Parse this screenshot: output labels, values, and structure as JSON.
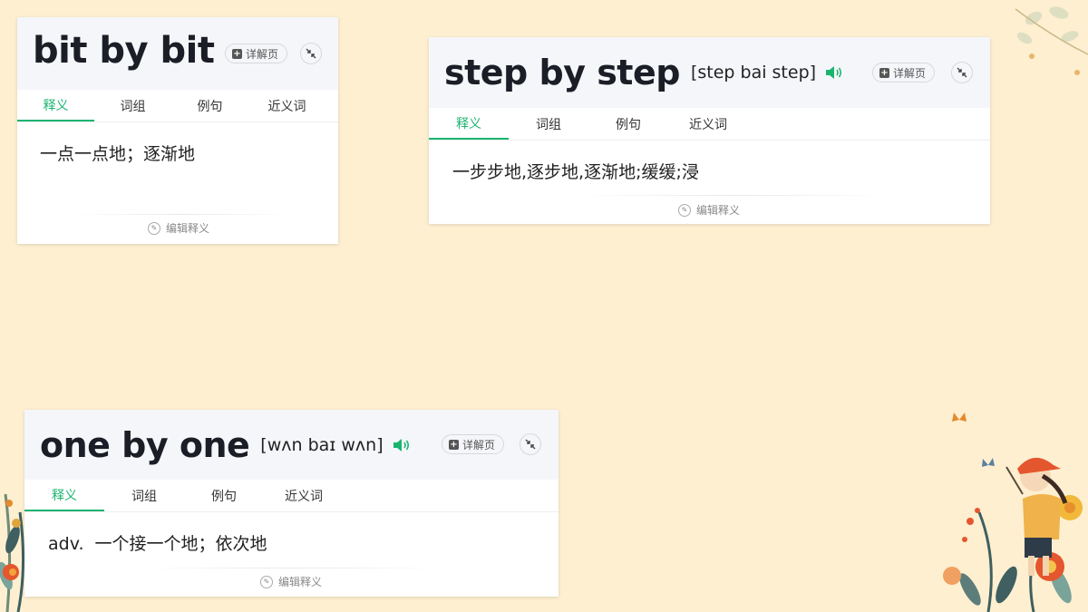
{
  "background": {
    "color": "#fdefd0"
  },
  "accent_color": "#1bb46f",
  "cards": [
    {
      "word": "bit by bit",
      "phonetic": "",
      "detail_label": "详解页",
      "tabs": [
        "释义",
        "词组",
        "例句",
        "近义词"
      ],
      "active_tab": "释义",
      "definition_pos": "",
      "definition": "一点一点地；逐渐地",
      "edit_label": "编辑释义"
    },
    {
      "word": "step by step",
      "phonetic": "[step bai step]",
      "detail_label": "详解页",
      "tabs": [
        "释义",
        "词组",
        "例句",
        "近义词"
      ],
      "active_tab": "释义",
      "definition_pos": "",
      "definition": "一步步地,逐步地,逐渐地;缓缓;浸",
      "edit_label": "编辑释义"
    },
    {
      "word": "one by one",
      "phonetic": "[wʌn baɪ wʌn]",
      "detail_label": "详解页",
      "tabs": [
        "释义",
        "词组",
        "例句",
        "近义词"
      ],
      "active_tab": "释义",
      "definition_pos": "adv.",
      "definition": "一个接一个地；依次地",
      "edit_label": "编辑释义"
    }
  ],
  "icons": {
    "detail": "plus-page-icon",
    "collapse": "collapse-arrows-icon",
    "speaker": "speaker-icon",
    "edit": "pencil-icon"
  }
}
